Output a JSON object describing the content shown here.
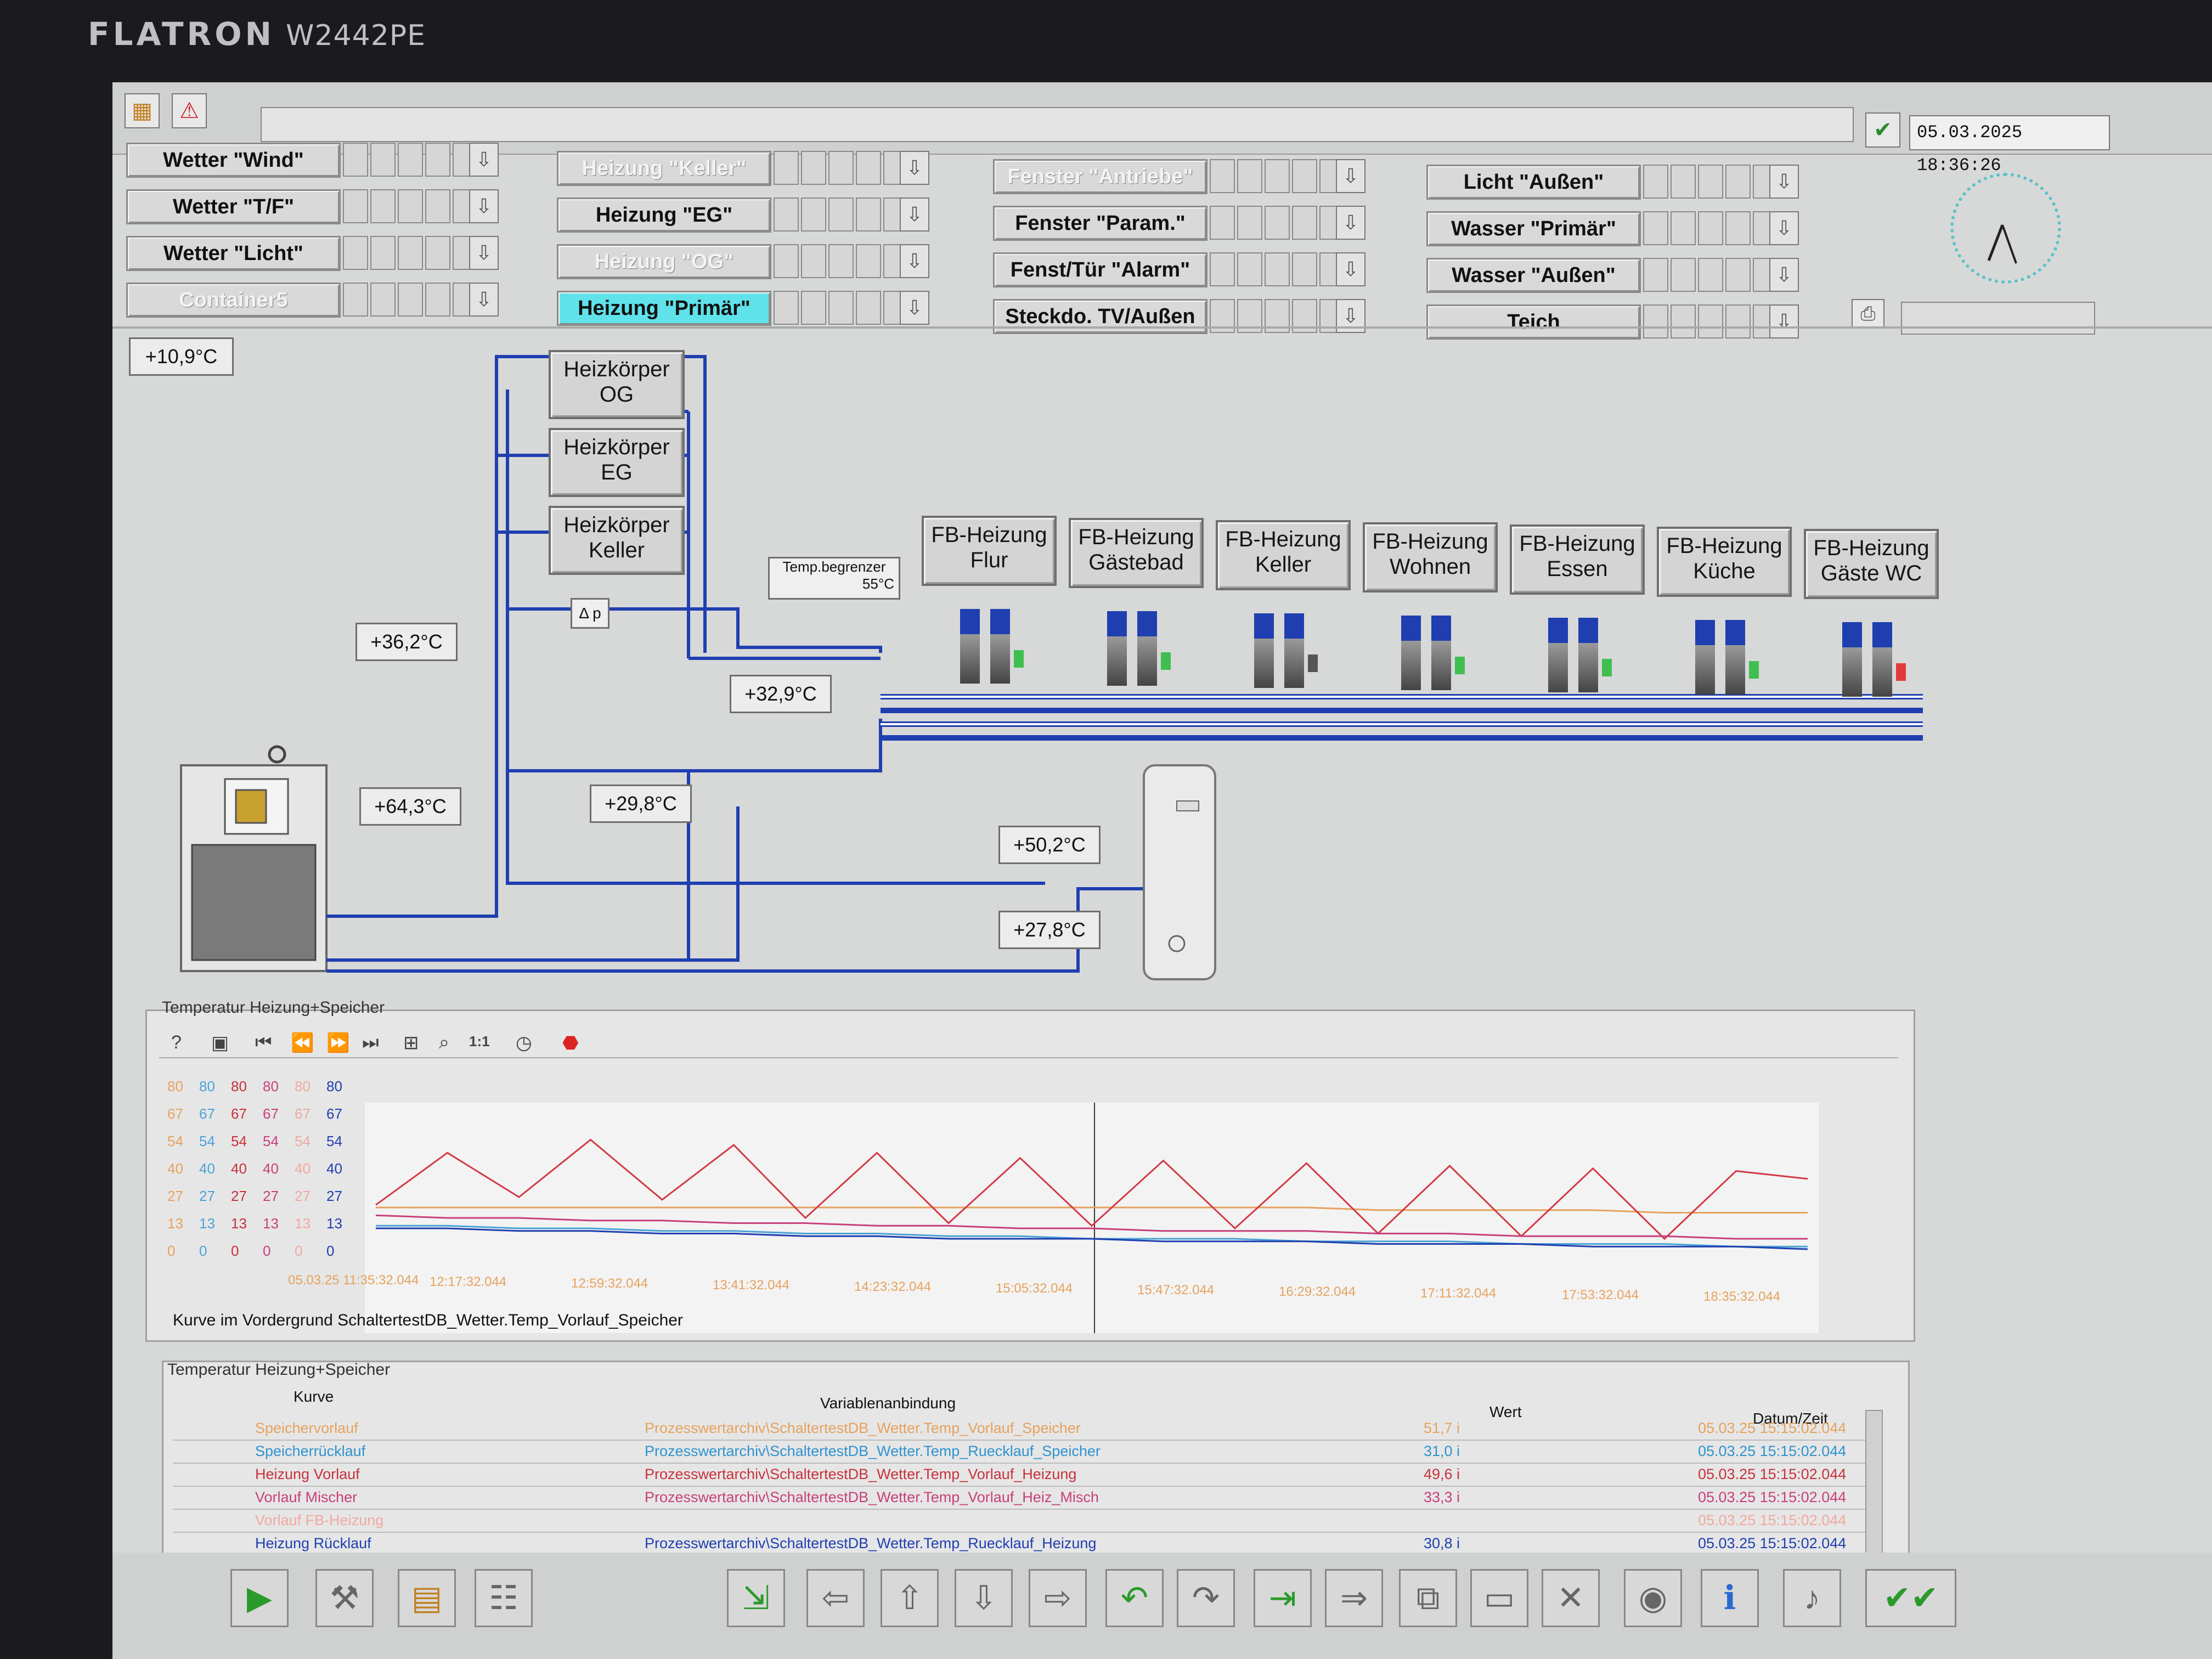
{
  "monitor": {
    "brand": "FLATRON",
    "model": "W2442PE"
  },
  "header": {
    "datetime": "05.03.2025 18:36:26"
  },
  "nav_buttons": [
    {
      "label": "Wetter \"Wind\"",
      "style": "normal"
    },
    {
      "label": "Wetter \"T/F\"",
      "style": "normal"
    },
    {
      "label": "Wetter \"Licht\"",
      "style": "normal"
    },
    {
      "label": "Container5",
      "style": "dim"
    },
    {
      "label": "Heizung \"Keller\"",
      "style": "dim"
    },
    {
      "label": "Heizung \"EG\"",
      "style": "normal"
    },
    {
      "label": "Heizung \"OG\"",
      "style": "dim"
    },
    {
      "label": "Heizung \"Primär\"",
      "style": "active"
    },
    {
      "label": "Fenster \"Antriebe\"",
      "style": "dim"
    },
    {
      "label": "Fenster \"Param.\"",
      "style": "normal"
    },
    {
      "label": "Fenst/Tür \"Alarm\"",
      "style": "normal"
    },
    {
      "label": "Steckdo. TV/Außen",
      "style": "normal"
    },
    {
      "label": "Licht \"Außen\"",
      "style": "normal"
    },
    {
      "label": "Wasser \"Primär\"",
      "style": "normal"
    },
    {
      "label": "Wasser \"Außen\"",
      "style": "normal"
    },
    {
      "label": "Teich",
      "style": "normal"
    }
  ],
  "process": {
    "outdoor_temp": "+10,9°C",
    "radiators": [
      "Heizkörper\nOG",
      "Heizkörper\nEG",
      "Heizkörper\nKeller"
    ],
    "temp_limiter": {
      "label": "Temp.begrenzer",
      "value": "55°C"
    },
    "dp_label": "Δ p",
    "temps": {
      "t1": "+36,2°C",
      "t2": "+64,3°C",
      "t3": "+32,9°C",
      "t4": "+29,8°C",
      "t5": "+50,2°C",
      "t6": "+27,8°C"
    },
    "floor_heating": [
      {
        "label": "FB-Heizung\nFlur",
        "led": "#3fbf4f"
      },
      {
        "label": "FB-Heizung\nGästebad",
        "led": "#3fbf4f"
      },
      {
        "label": "FB-Heizung\nKeller",
        "led": "#555555"
      },
      {
        "label": "FB-Heizung\nWohnen",
        "led": "#3fbf4f"
      },
      {
        "label": "FB-Heizung\nEssen",
        "led": "#3fbf4f"
      },
      {
        "label": "FB-Heizung\nKüche",
        "led": "#3fbf4f"
      },
      {
        "label": "FB-Heizung\nGäste WC",
        "led": "#e03a3a"
      }
    ]
  },
  "trend": {
    "title": "Temperatur Heizung+Speicher",
    "footer": "Kurve im Vordergrund SchaltertestDB_Wetter.Temp_Vorlauf_Speicher",
    "zoom_label": "1:1"
  },
  "chart_data": {
    "type": "line",
    "y_axes": [
      {
        "color": "#e6a25d",
        "ticks": [
          "80",
          "67",
          "54",
          "40",
          "27",
          "13",
          "0"
        ]
      },
      {
        "color": "#4aa3d6",
        "ticks": [
          "80",
          "67",
          "54",
          "40",
          "27",
          "13",
          "0"
        ]
      },
      {
        "color": "#c8323c",
        "ticks": [
          "80",
          "67",
          "54",
          "40",
          "27",
          "13",
          "0"
        ]
      },
      {
        "color": "#c8407a",
        "ticks": [
          "80",
          "67",
          "54",
          "40",
          "27",
          "13",
          "0"
        ]
      },
      {
        "color": "#f0a8a0",
        "ticks": [
          "80",
          "67",
          "54",
          "40",
          "27",
          "13",
          "0"
        ]
      },
      {
        "color": "#1f3fb0",
        "ticks": [
          "80",
          "67",
          "54",
          "40",
          "27",
          "13",
          "0"
        ]
      }
    ],
    "ylim": [
      0,
      80
    ],
    "x_ticks": [
      "05.03.25 11:35:32.044",
      "12:17:32.044",
      "12:59:32.044",
      "13:41:32.044",
      "14:23:32.044",
      "15:05:32.044",
      "15:47:32.044",
      "16:29:32.044",
      "17:11:32.044",
      "17:53:32.044",
      "18:35:32.044"
    ],
    "series": [
      {
        "color": "#e6a25d",
        "values": [
          44,
          44,
          44,
          44,
          44,
          44,
          44,
          44,
          44,
          44,
          44,
          44,
          44,
          44,
          43,
          43,
          43,
          43,
          42,
          42,
          42
        ]
      },
      {
        "color": "#d23a46",
        "values": [
          45,
          65,
          48,
          70,
          47,
          68,
          40,
          65,
          38,
          63,
          37,
          62,
          36,
          61,
          34,
          60,
          33,
          59,
          32,
          58,
          55
        ]
      },
      {
        "color": "#c8407a",
        "values": [
          41,
          40,
          40,
          39,
          39,
          38,
          38,
          37,
          37,
          36,
          36,
          35,
          35,
          35,
          34,
          34,
          33,
          33,
          33,
          32,
          32
        ]
      },
      {
        "color": "#4aa3d6",
        "values": [
          37,
          37,
          36,
          36,
          35,
          35,
          34,
          34,
          33,
          33,
          32,
          32,
          32,
          31,
          31,
          31,
          30,
          30,
          30,
          29,
          29
        ]
      },
      {
        "color": "#1f3fb0",
        "values": [
          36,
          36,
          35,
          35,
          34,
          34,
          33,
          33,
          32,
          32,
          32,
          31,
          31,
          31,
          30,
          30,
          30,
          29,
          29,
          29,
          28
        ]
      }
    ]
  },
  "table": {
    "title": "Temperatur Heizung+Speicher",
    "headers": [
      "Kurve",
      "Variablenanbindung",
      "Wert",
      "Datum/Zeit"
    ],
    "rows": [
      {
        "kurve": "Speichervorlauf",
        "var": "Prozesswertarchiv\\SchaltertestDB_Wetter.Temp_Vorlauf_Speicher",
        "wert": "51,7 i",
        "zeit": "05.03.25 15:15:02.044",
        "color": "#e6a25d"
      },
      {
        "kurve": "Speicherrücklauf",
        "var": "Prozesswertarchiv\\SchaltertestDB_Wetter.Temp_Ruecklauf_Speicher",
        "wert": "31,0 i",
        "zeit": "05.03.25 15:15:02.044",
        "color": "#2f93cf"
      },
      {
        "kurve": "Heizung Vorlauf",
        "var": "Prozesswertarchiv\\SchaltertestDB_Wetter.Temp_Vorlauf_Heizung",
        "wert": "49,6 i",
        "zeit": "05.03.25 15:15:02.044",
        "color": "#c8323c"
      },
      {
        "kurve": "Vorlauf Mischer",
        "var": "Prozesswertarchiv\\SchaltertestDB_Wetter.Temp_Vorlauf_Heiz_Misch",
        "wert": "33,3 i",
        "zeit": "05.03.25 15:15:02.044",
        "color": "#c8407a"
      },
      {
        "kurve": "Vorlauf FB-Heizung",
        "var": "",
        "wert": "",
        "zeit": "05.03.25 15:15:02.044",
        "color": "#f0a8a0"
      },
      {
        "kurve": "Heizung Rücklauf",
        "var": "Prozesswertarchiv\\SchaltertestDB_Wetter.Temp_Ruecklauf_Heizung",
        "wert": "30,8 i",
        "zeit": "05.03.25 15:15:02.044",
        "color": "#1f3fb0"
      }
    ]
  }
}
